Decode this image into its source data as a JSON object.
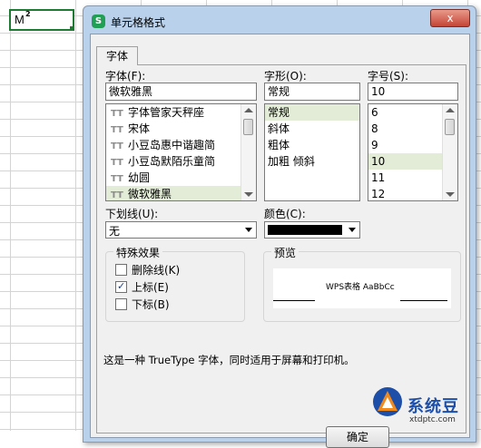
{
  "spreadsheet": {
    "cell_text": "M",
    "cell_superscript": "2"
  },
  "dialog": {
    "app_icon": "S",
    "title": "单元格格式",
    "close_label": "x",
    "tab_label": "字体",
    "font": {
      "label": "字体(F):",
      "value": "微软雅黑",
      "items": [
        {
          "label": "字体管家天秤座",
          "selected": false
        },
        {
          "label": "宋体",
          "selected": false
        },
        {
          "label": "小豆岛惠中谐趣简",
          "selected": false
        },
        {
          "label": "小豆岛默陌乐童简",
          "selected": false
        },
        {
          "label": "幼圆",
          "selected": false
        },
        {
          "label": "微软雅黑",
          "selected": true
        }
      ],
      "glyph": "T"
    },
    "style": {
      "label": "字形(O):",
      "value": "常规",
      "items": [
        {
          "label": "常规",
          "selected": true
        },
        {
          "label": "斜体",
          "selected": false
        },
        {
          "label": "粗体",
          "selected": false
        },
        {
          "label": "加粗 倾斜",
          "selected": false
        }
      ]
    },
    "size": {
      "label": "字号(S):",
      "value": "10",
      "items": [
        {
          "label": "6",
          "selected": false
        },
        {
          "label": "8",
          "selected": false
        },
        {
          "label": "9",
          "selected": false
        },
        {
          "label": "10",
          "selected": true
        },
        {
          "label": "11",
          "selected": false
        },
        {
          "label": "12",
          "selected": false
        }
      ]
    },
    "underline": {
      "label": "下划线(U):",
      "value": "无"
    },
    "color": {
      "label": "颜色(C):",
      "swatch": "#000000"
    },
    "effects": {
      "title": "特殊效果",
      "strikethrough": {
        "label": "删除线(K)",
        "checked": false
      },
      "superscript": {
        "label": "上标(E)",
        "checked": true
      },
      "subscript": {
        "label": "下标(B)",
        "checked": false
      }
    },
    "preview": {
      "title": "预览",
      "sample": "WPS表格  AaBbCc"
    },
    "description": "这是一种 TrueType 字体，同时适用于屏幕和打印机。",
    "ok_label": "确定"
  },
  "watermark": {
    "name": "系统豆",
    "url": "xtdptc.com",
    "colors": {
      "blue": "#1d4fa8",
      "orange": "#f08a1c"
    }
  }
}
